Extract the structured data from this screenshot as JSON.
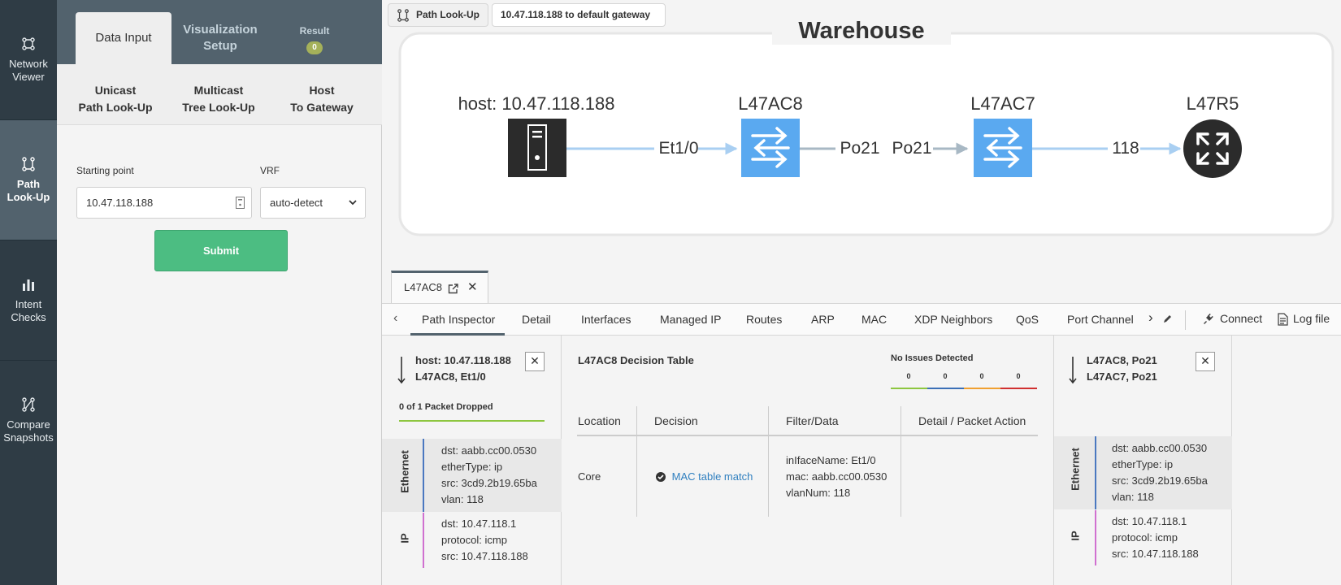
{
  "rail": {
    "items": [
      {
        "label_1": "Network",
        "label_2": "Viewer",
        "icon": "network-viewer-icon"
      },
      {
        "label_1": "Path",
        "label_2": "Look-Up",
        "icon": "path-lookup-icon"
      },
      {
        "label_1": "Intent",
        "label_2": "Checks",
        "icon": "bar-chart-icon"
      },
      {
        "label_1": "Compare",
        "label_2": "Snapshots",
        "icon": "compare-icon"
      }
    ]
  },
  "panel": {
    "tabs": {
      "data_input": "Data Input",
      "viz_1": "Visualization",
      "viz_2": "Setup",
      "result": "Result",
      "result_count": "0"
    },
    "subtabs": {
      "unicast_1": "Unicast",
      "unicast_2": "Path Look-Up",
      "multicast_1": "Multicast",
      "multicast_2": "Tree Look-Up",
      "host_1": "Host",
      "host_2": "To Gateway"
    },
    "form": {
      "starting_point_label": "Starting point",
      "starting_point_value": "10.47.118.188",
      "vrf_label": "VRF",
      "vrf_value": "auto-detect",
      "submit_label": "Submit"
    }
  },
  "breadcrumb": {
    "path_lookup": "Path Look-Up",
    "query": "10.47.118.188 to default gateway"
  },
  "diagram": {
    "title": "Warehouse",
    "nodes": [
      {
        "label": "host: 10.47.118.188",
        "type": "server"
      },
      {
        "label": "L47AC8",
        "type": "switch"
      },
      {
        "label": "L47AC7",
        "type": "switch"
      },
      {
        "label": "L47R5",
        "type": "router"
      }
    ],
    "links": [
      {
        "label": "Et1/0"
      },
      {
        "label_a": "Po21",
        "label_b": "Po21"
      },
      {
        "label": "118"
      }
    ],
    "colors": {
      "switch": "#5aa9f0",
      "link": "#a9cff2",
      "server": "#2b2b2b",
      "router": "#2b2b2b"
    }
  },
  "device_tab": {
    "label": "L47AC8"
  },
  "nav": {
    "items": [
      "Path Inspector",
      "Detail",
      "Interfaces",
      "Managed IP",
      "Routes",
      "ARP",
      "MAC",
      "XDP Neighbors",
      "QoS",
      "Port Channel"
    ],
    "connect": "Connect",
    "log_file": "Log file"
  },
  "hop1": {
    "line_1": "host: 10.47.118.188",
    "line_2": "L47AC8, Et1/0",
    "dropped": "0 of 1 Packet Dropped",
    "ethernet_label": "Ethernet",
    "ethernet": [
      "dst: aabb.cc00.0530",
      "etherType: ip",
      "src: 3cd9.2b19.65ba",
      "vlan: 118"
    ],
    "ip_label": "IP",
    "ip": [
      "dst: 10.47.118.1",
      "protocol: icmp",
      "src: 10.47.118.188"
    ]
  },
  "decision": {
    "title": "L47AC8 Decision Table",
    "issues_label": "No Issues Detected",
    "counts": [
      "0",
      "0",
      "0",
      "0"
    ],
    "count_colors": [
      "#8dc63f",
      "#3b6fb6",
      "#f0a030",
      "#d03030"
    ],
    "headers": [
      "Location",
      "Decision",
      "Filter/Data",
      "Detail / Packet Action"
    ],
    "row": {
      "location": "Core",
      "decision": "MAC table match",
      "filter": [
        "inIfaceName: Et1/0",
        "mac: aabb.cc00.0530",
        "vlanNum: 118"
      ],
      "detail": ""
    }
  },
  "hop2": {
    "line_1": "L47AC8, Po21",
    "line_2": "L47AC7, Po21",
    "ethernet_label": "Ethernet",
    "ethernet": [
      "dst: aabb.cc00.0530",
      "etherType: ip",
      "src: 3cd9.2b19.65ba",
      "vlan: 118"
    ],
    "ip_label": "IP",
    "ip": [
      "dst: 10.47.118.1",
      "protocol: icmp",
      "src: 10.47.118.188"
    ]
  }
}
